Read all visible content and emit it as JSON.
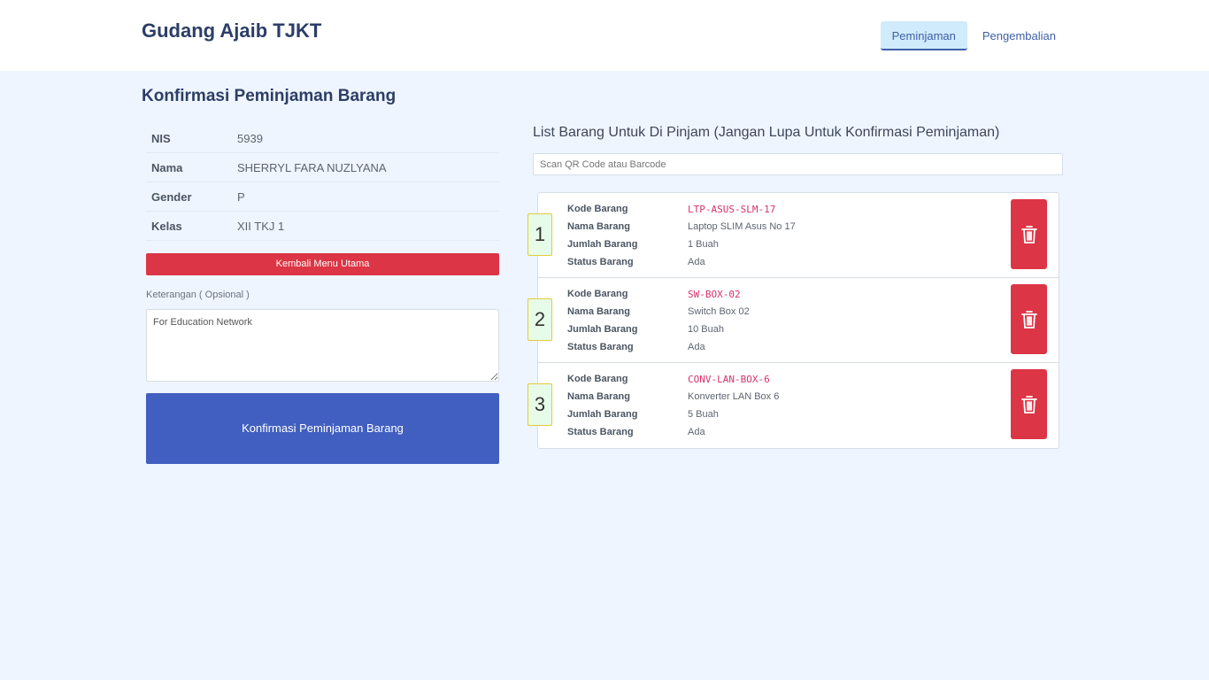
{
  "header": {
    "brand": "Gudang Ajaib TJKT",
    "nav": [
      {
        "label": "Peminjaman",
        "active": true
      },
      {
        "label": "Pengembalian",
        "active": false
      }
    ]
  },
  "page_title": "Konfirmasi Peminjaman Barang",
  "student": {
    "rows": [
      {
        "label": "NIS",
        "value": "5939"
      },
      {
        "label": "Nama",
        "value": "SHERRYL FARA NUZLYANA"
      },
      {
        "label": "Gender",
        "value": "P"
      },
      {
        "label": "Kelas",
        "value": "XII TKJ 1"
      }
    ]
  },
  "back_button": "Kembali Menu Utama",
  "keterangan": {
    "label": "Keterangan ( Opsional )",
    "value": "For Education Network"
  },
  "confirm_button": "Konfirmasi Peminjaman Barang",
  "list": {
    "title": "List Barang Untuk Di Pinjam (Jangan Lupa Untuk Konfirmasi Peminjaman)",
    "scan_placeholder": "Scan QR Code atau Barcode",
    "field_labels": {
      "kode": "Kode Barang",
      "nama": "Nama Barang",
      "jumlah": "Jumlah Barang",
      "status": "Status Barang"
    },
    "items": [
      {
        "no": "1",
        "kode": "LTP-ASUS-SLM-17",
        "nama": "Laptop SLIM Asus No 17",
        "jumlah": "1 Buah",
        "status": "Ada"
      },
      {
        "no": "2",
        "kode": "SW-BOX-02",
        "nama": "Switch Box 02",
        "jumlah": "10 Buah",
        "status": "Ada"
      },
      {
        "no": "3",
        "kode": "CONV-LAN-BOX-6",
        "nama": "Konverter LAN Box 6",
        "jumlah": "5 Buah",
        "status": "Ada"
      }
    ]
  },
  "colors": {
    "danger": "#dc3545",
    "primary": "#415fc0",
    "background": "#eff5fe",
    "code": "#d6336c"
  },
  "icons": {
    "delete": "trash-icon"
  }
}
